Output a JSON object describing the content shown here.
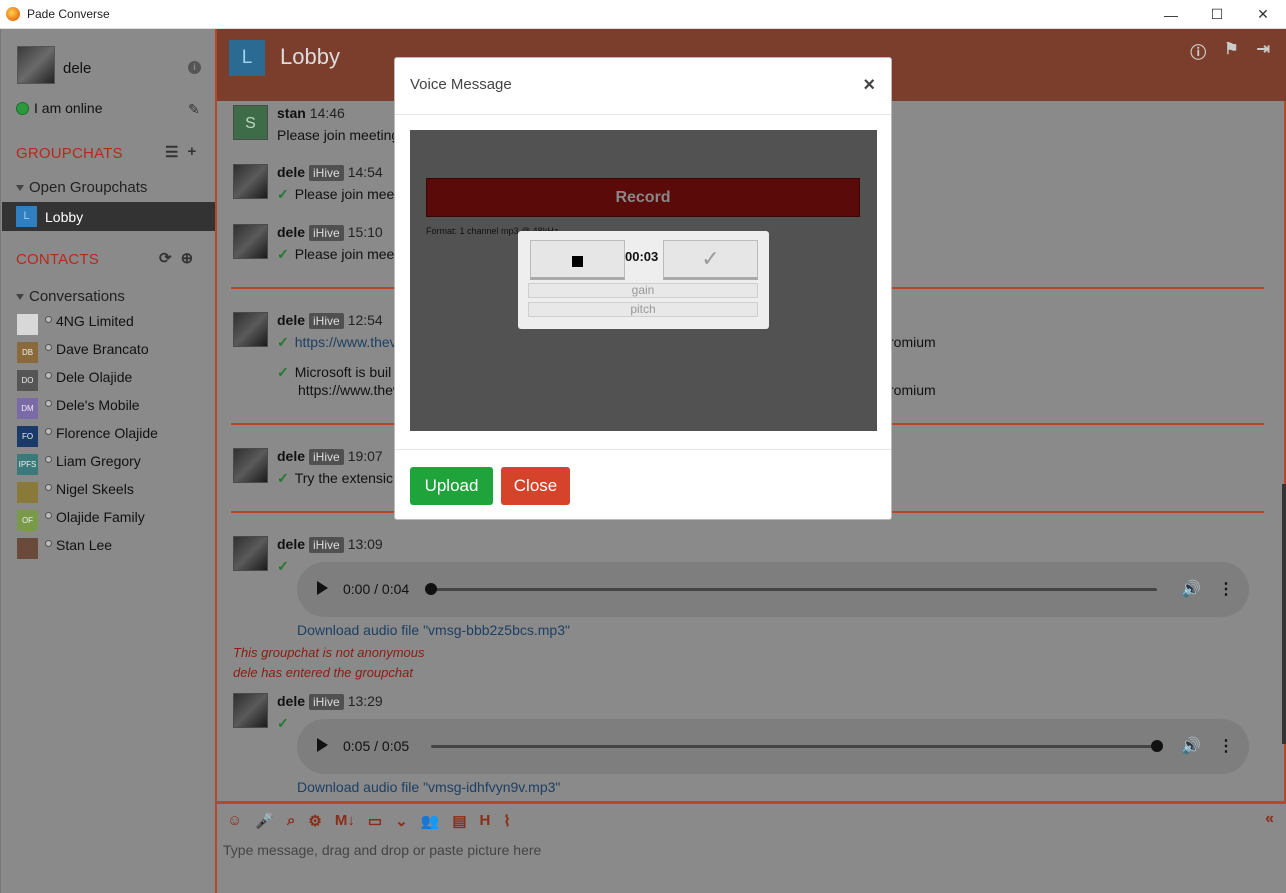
{
  "window": {
    "title": "Pade Converse",
    "minimize": "—",
    "maximize": "☐",
    "close": "✕"
  },
  "sidebar": {
    "user": {
      "name": "dele",
      "status": "I am online"
    },
    "groupchats": {
      "heading": "GROUPCHATS",
      "subheading": "Open Groupchats",
      "rooms": [
        {
          "badge": "L",
          "label": "Lobby"
        }
      ]
    },
    "contacts": {
      "heading": "CONTACTS",
      "subheading": "Conversations",
      "items": [
        {
          "initials": "",
          "name": "4NG Limited",
          "color": "#d8d8d8"
        },
        {
          "initials": "DB",
          "name": "Dave Brancato",
          "color": "#8a6a3a"
        },
        {
          "initials": "DO",
          "name": "Dele Olajide",
          "color": "#555555"
        },
        {
          "initials": "DM",
          "name": "Dele's Mobile",
          "color": "#7a6aa8"
        },
        {
          "initials": "FO",
          "name": "Florence Olajide",
          "color": "#1a3a6a"
        },
        {
          "initials": "IPFS",
          "name": "Liam Gregory",
          "color": "#3a7a7a"
        },
        {
          "initials": "",
          "name": "Nigel Skeels",
          "color": "#8a7a3a"
        },
        {
          "initials": "OF",
          "name": "Olajide Family",
          "color": "#7a9a4a"
        },
        {
          "initials": "",
          "name": "Stan Lee",
          "color": "#6a4a3a"
        }
      ]
    }
  },
  "chat": {
    "room_badge": "L",
    "room_name": "Lobby",
    "messages": [
      {
        "sender": "stan",
        "avatar": "S",
        "tag": "",
        "time": "14:46",
        "lines": [
          "Please join meeting"
        ]
      },
      {
        "sender": "dele",
        "tag": "iHive",
        "time": "14:54",
        "lines": [
          "Please join mee"
        ]
      },
      {
        "sender": "dele",
        "tag": "iHive",
        "time": "15:10",
        "lines": [
          "Please join mee"
        ]
      },
      {
        "sender": "dele",
        "tag": "iHive",
        "time": "12:54",
        "lines": [
          "https://www.thev",
          "Microsoft is buil",
          "https://www.thev"
        ],
        "tail": "romium"
      },
      {
        "sender": "dele",
        "tag": "iHive",
        "time": "19:07",
        "lines": [
          "Try the extensic"
        ]
      },
      {
        "sender": "dele",
        "tag": "iHive",
        "time": "13:09",
        "audio_time": "0:00 / 0:04",
        "progress": 0.0,
        "download": "Download audio file \"vmsg-bbb2z5bcs.mp3\""
      },
      {
        "sender": "dele",
        "tag": "iHive",
        "time": "13:29",
        "audio_time": "0:05 / 0:05",
        "progress": 1.0,
        "download": "Download audio file \"vmsg-idhfvyn9v.mp3\""
      }
    ],
    "system_notes": [
      "This groupchat is not anonymous",
      "dele has entered the groupchat"
    ],
    "composer_placeholder": "Type message, drag and drop or paste picture here"
  },
  "modal": {
    "title": "Voice Message",
    "record_label": "Record",
    "format_text": "Format: 1 channel mp3 @ 48kHz",
    "elapsed": "00:03",
    "ok_glyph": "✓",
    "gain_label": "gain",
    "pitch_label": "pitch",
    "upload_label": "Upload",
    "close_label": "Close"
  },
  "colors": {
    "accent": "#b5472b",
    "upload": "#1ea43a",
    "close": "#d4432a"
  }
}
